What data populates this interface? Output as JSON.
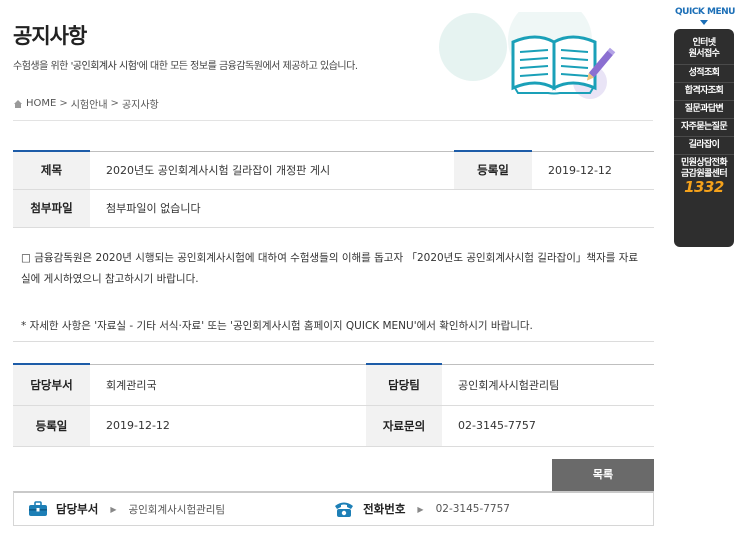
{
  "header": {
    "title": "공지사항",
    "description_pre": "수험생을 위한 ",
    "description_highlight": "'공인회계사 시험'",
    "description_post": "에 대한 모든 정보를 금융감독원에서 제공하고 있습니다."
  },
  "breadcrumb": {
    "home": "HOME",
    "sep": ">",
    "level1": "시험안내",
    "level2": "공지사항"
  },
  "post": {
    "title_label": "제목",
    "title_value": "2020년도 공인회계사시험 길라잡이 개정판 게시",
    "date_label": "등록일",
    "date_value": "2019-12-12",
    "attach_label": "첨부파일",
    "attach_value": "첨부파일이 없습니다",
    "body_para1": "□ 금융감독원은 2020년 시행되는 공인회계사시험에 대하여 수험생들의 이해를 돕고자 「2020년도 공인회계사시험 길라잡이」책자를 자료실에 게시하였으니 참고하시기 바랍니다.",
    "body_para2": "* 자세한 사항은 '자료실 - 기타 서식·자료' 또는 '공인회계사시험 홈페이지 QUICK MENU'에서 확인하시기 바랍니다."
  },
  "meta": {
    "dept_label": "담당부서",
    "dept_value": "회계관리국",
    "team_label": "담당팀",
    "team_value": "공인회계사시험관리팀",
    "date_label": "등록일",
    "date_value": "2019-12-12",
    "inquiry_label": "자료문의",
    "inquiry_value": "02-3145-7757"
  },
  "list_button": "목록",
  "contact": {
    "dept_label": "담당부서",
    "dept_value": "공인회계사시험관리팀",
    "phone_label": "전화번호",
    "phone_value": "02-3145-7757"
  },
  "quick_menu": {
    "title": "QUICK MENU",
    "items": [
      {
        "line1": "인터넷",
        "line2": "원서접수"
      },
      {
        "line1": "성적조회"
      },
      {
        "line1": "합격자조회"
      },
      {
        "line1": "질문과답변"
      },
      {
        "line1": "자주묻는질문"
      },
      {
        "line1": "길라잡이"
      },
      {
        "line1": "민원상담전화",
        "line2": "금감원콜센터"
      }
    ],
    "callcenter_number": "1332"
  },
  "colors": {
    "accent": "#1d5ca8",
    "quick_title": "#1c6fb7",
    "quick_bg": "#2e2e2e",
    "callcenter": "#f5a21b",
    "list_button_bg": "#6a6a6a"
  }
}
